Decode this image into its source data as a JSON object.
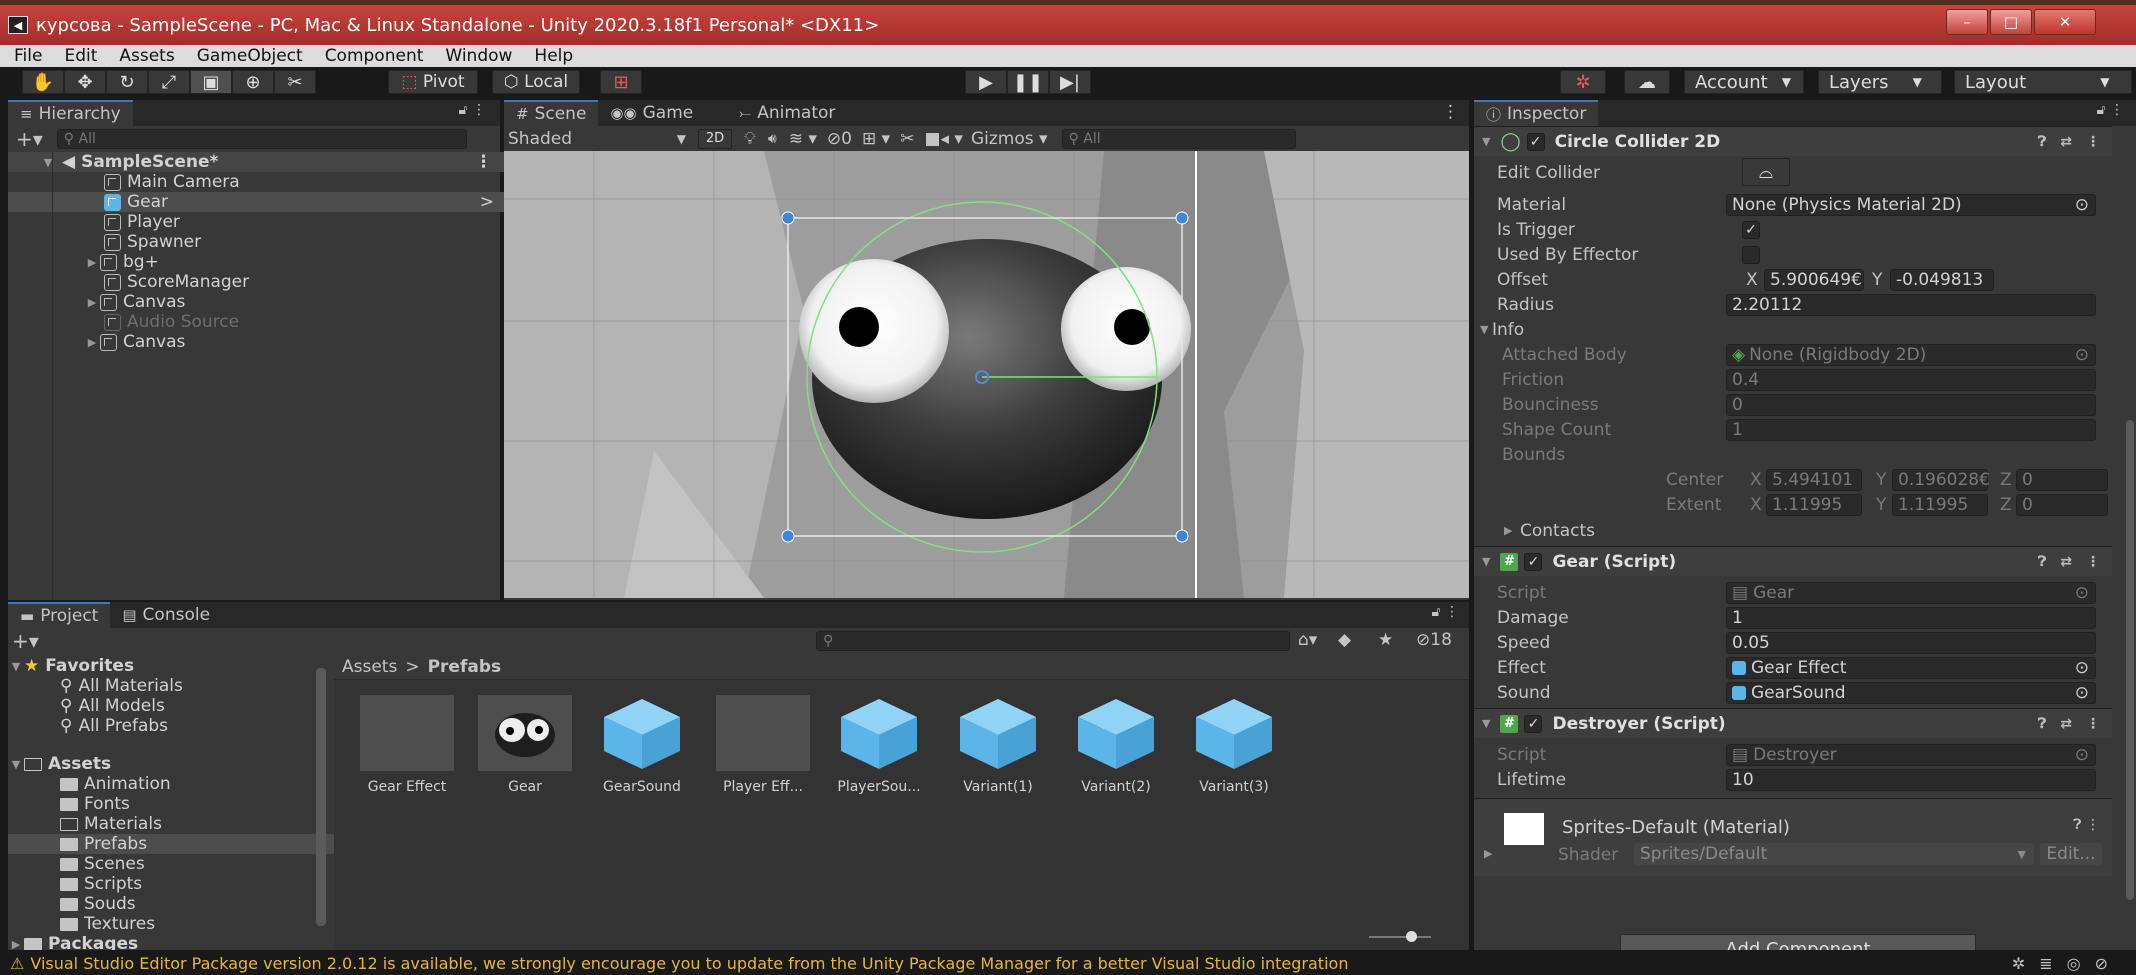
{
  "window": {
    "title": "курсова - SampleScene - PC, Mac & Linux Standalone - Unity 2020.3.18f1 Personal* <DX11>",
    "minimize": "–",
    "maximize": "□",
    "close": "✕"
  },
  "menu": [
    "File",
    "Edit",
    "Assets",
    "GameObject",
    "Component",
    "Window",
    "Help"
  ],
  "toolbar": {
    "pivot": "Pivot",
    "local": "Local",
    "account": "Account",
    "layers": "Layers",
    "layout": "Layout"
  },
  "hierarchy": {
    "tab": "Hierarchy",
    "search_placeholder": "All",
    "scene": "SampleScene*",
    "items": [
      "Main Camera",
      "Gear",
      "Player",
      "Spawner",
      "bg+",
      "ScoreManager",
      "Canvas",
      "Audio Source",
      "Canvas"
    ]
  },
  "scene": {
    "tabs": [
      "Scene",
      "Game",
      "Animator"
    ],
    "shading": "Shaded",
    "mode2d": "2D",
    "hidden_count": "0",
    "gizmos": "Gizmos",
    "search_placeholder": "All"
  },
  "inspector": {
    "tab": "Inspector",
    "collider": {
      "title": "Circle Collider 2D",
      "edit_collider": "Edit Collider",
      "material_label": "Material",
      "material": "None (Physics Material 2D)",
      "is_trigger": "Is Trigger",
      "used_by_effector": "Used By Effector",
      "offset_label": "Offset",
      "offset_x": "5.900649€",
      "offset_y": "-0.049813",
      "radius_label": "Radius",
      "radius": "2.20112",
      "info": "Info",
      "attached_body_label": "Attached Body",
      "attached_body": "None (Rigidbody 2D)",
      "friction_label": "Friction",
      "friction": "0.4",
      "bounciness_label": "Bounciness",
      "bounciness": "0",
      "shape_count_label": "Shape Count",
      "shape_count": "1",
      "bounds_label": "Bounds",
      "center_label": "Center",
      "center_x": "5.494101",
      "center_y": "0.196028€",
      "center_z": "0",
      "extent_label": "Extent",
      "extent_x": "1.11995",
      "extent_y": "1.11995",
      "extent_z": "0",
      "contacts": "Contacts"
    },
    "gear_script": {
      "title": "Gear (Script)",
      "script_label": "Script",
      "script": "Gear",
      "damage_label": "Damage",
      "damage": "1",
      "speed_label": "Speed",
      "speed": "0.05",
      "effect_label": "Effect",
      "effect": "Gear Effect",
      "sound_label": "Sound",
      "sound": "GearSound"
    },
    "destroyer": {
      "title": "Destroyer (Script)",
      "script_label": "Script",
      "script": "Destroyer",
      "lifetime_label": "Lifetime",
      "lifetime": "10"
    },
    "material": {
      "name": "Sprites-Default (Material)",
      "shader_label": "Shader",
      "shader": "Sprites/Default",
      "edit": "Edit..."
    },
    "add_component": "Add Component"
  },
  "project": {
    "tabs": [
      "Project",
      "Console"
    ],
    "hidden_count": "18",
    "favorites": "Favorites",
    "favorite_items": [
      "All Materials",
      "All Models",
      "All Prefabs"
    ],
    "assets": "Assets",
    "folders": [
      "Animation",
      "Fonts",
      "Materials",
      "Prefabs",
      "Scenes",
      "Scripts",
      "Souds",
      "Textures"
    ],
    "packages": "Packages",
    "breadcrumb_root": "Assets",
    "breadcrumb_sep": ">",
    "breadcrumb_current": "Prefabs",
    "assets_list": [
      "Gear Effect",
      "Gear",
      "GearSound",
      "Player Eff...",
      "PlayerSou...",
      "Variant(1)",
      "Variant(2)",
      "Variant(3)"
    ]
  },
  "status": {
    "message": "Visual Studio Editor Package version 2.0.12 is available, we strongly encourage you to update from the Unity Package Manager for a better Visual Studio integration"
  },
  "colors": {
    "accent": "#3a79bb",
    "titlebar": "#b3352f",
    "warning": "#e8b53c",
    "prefab_blue": "#5bb5e8",
    "collider_green": "#7fe27f"
  }
}
